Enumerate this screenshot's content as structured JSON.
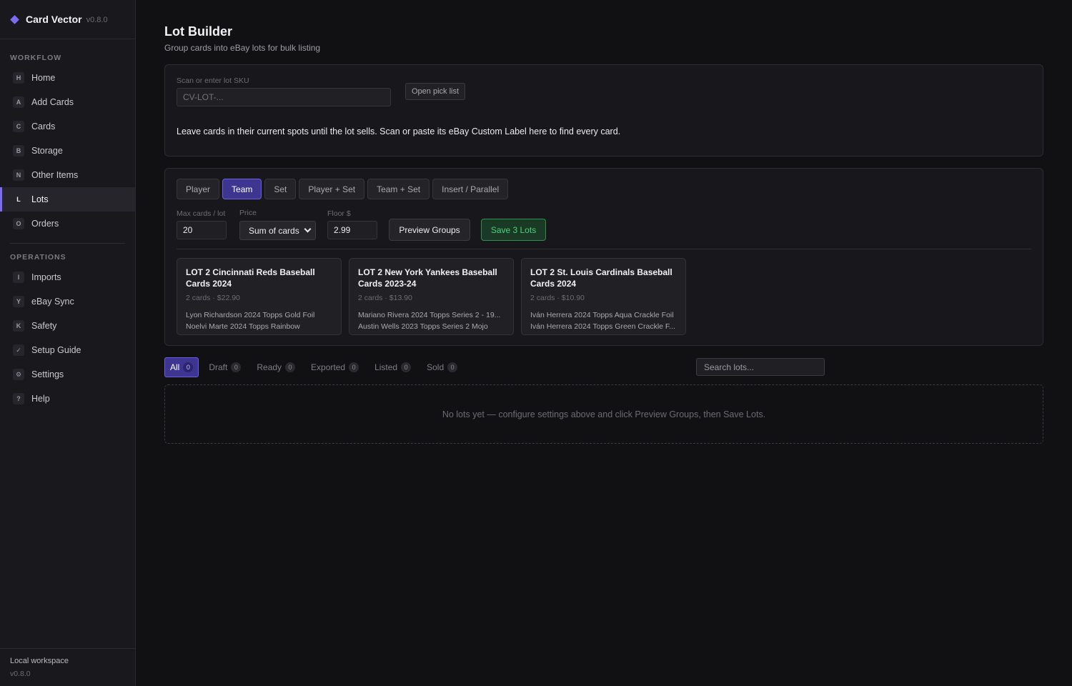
{
  "app": {
    "name": "Card Vector",
    "version": "v0.8.0"
  },
  "sidebar": {
    "workflow_label": "WORKFLOW",
    "workflow": [
      {
        "key": "H",
        "label": "Home"
      },
      {
        "key": "A",
        "label": "Add Cards"
      },
      {
        "key": "C",
        "label": "Cards"
      },
      {
        "key": "B",
        "label": "Storage"
      },
      {
        "key": "N",
        "label": "Other Items"
      },
      {
        "key": "L",
        "label": "Lots",
        "active": true
      },
      {
        "key": "O",
        "label": "Orders"
      }
    ],
    "operations_label": "OPERATIONS",
    "operations": [
      {
        "key": "I",
        "label": "Imports"
      },
      {
        "key": "Y",
        "label": "eBay Sync"
      },
      {
        "key": "K",
        "label": "Safety"
      },
      {
        "key": "✓",
        "label": "Setup Guide"
      },
      {
        "key": "⚙",
        "label": "Settings"
      },
      {
        "key": "?",
        "label": "Help"
      }
    ],
    "footer": {
      "workspace": "Local workspace",
      "version": "v0.8.0"
    }
  },
  "page": {
    "title": "Lot Builder",
    "subtitle": "Group cards into eBay lots for bulk listing"
  },
  "scan": {
    "label": "Scan or enter lot SKU",
    "placeholder": "CV-LOT-...",
    "pick_list_button": "Open pick list",
    "message": "Leave cards in their current spots until the lot sells. Scan or paste its eBay Custom Label here to find every card."
  },
  "builder": {
    "group_tabs": [
      {
        "label": "Player"
      },
      {
        "label": "Team",
        "active": true
      },
      {
        "label": "Set"
      },
      {
        "label": "Player + Set"
      },
      {
        "label": "Team + Set"
      },
      {
        "label": "Insert / Parallel"
      }
    ],
    "max_cards_label": "Max cards / lot",
    "max_cards_value": "20",
    "price_label": "Price",
    "price_value": "Sum of cards",
    "floor_label": "Floor $",
    "floor_value": "2.99",
    "preview_button": "Preview Groups",
    "save_button": "Save 3 Lots",
    "lots": [
      {
        "title": "LOT 2 Cincinnati Reds Baseball Cards 2024",
        "meta": "2 cards · $22.90",
        "items": [
          "Lyon Richardson 2024 Topps Gold Foil",
          "Noelvi Marte 2024 Topps Rainbow"
        ]
      },
      {
        "title": "LOT 2 New York Yankees Baseball Cards 2023-24",
        "meta": "2 cards · $13.90",
        "items": [
          "Mariano Rivera 2024 Topps Series 2 - 19...",
          "Austin Wells 2023 Topps Series 2 Mojo"
        ]
      },
      {
        "title": "LOT 2 St. Louis Cardinals Baseball Cards 2024",
        "meta": "2 cards · $10.90",
        "items": [
          "Iván Herrera 2024 Topps Aqua Crackle Foil",
          "Iván Herrera 2024 Topps Green Crackle F..."
        ]
      }
    ]
  },
  "status_tabs": [
    {
      "label": "All",
      "count": "0",
      "active": true
    },
    {
      "label": "Draft",
      "count": "0"
    },
    {
      "label": "Ready",
      "count": "0"
    },
    {
      "label": "Exported",
      "count": "0"
    },
    {
      "label": "Listed",
      "count": "0"
    },
    {
      "label": "Sold",
      "count": "0"
    }
  ],
  "search": {
    "placeholder": "Search lots..."
  },
  "empty_message": "No lots yet — configure settings above and click Preview Groups, then Save Lots.",
  "colors": {
    "accent": "#7c6cf0",
    "save_green": "#4fd07a",
    "background": "#111114"
  }
}
